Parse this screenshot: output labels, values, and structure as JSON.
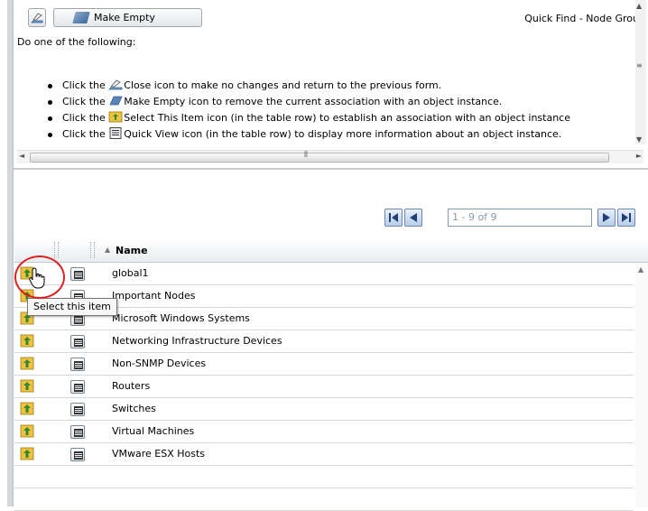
{
  "toolbar": {
    "make_empty_label": "Make Empty",
    "quick_find_title": "Quick Find - Node Grou"
  },
  "instructions": {
    "intro": "Do one of the following:",
    "steps": [
      {
        "pre": "Click the",
        "post": "Close icon to make no changes and return to the previous form.",
        "icon": "close-icon"
      },
      {
        "pre": "Click the",
        "post": "Make Empty icon to remove the current association with an object instance.",
        "icon": "make-empty-icon"
      },
      {
        "pre": "Click the",
        "post": "Select This Item icon (in the table row) to establish an association with an object instance",
        "icon": "select-item-icon"
      },
      {
        "pre": "Click the",
        "post": "Quick View icon (in the table row) to display more information about an object instance.",
        "icon": "quick-view-icon"
      }
    ]
  },
  "pager": {
    "range": "1 - 9 of 9"
  },
  "grid": {
    "column_name": "Name",
    "rows": [
      "global1",
      "Important Nodes",
      "Microsoft Windows Systems",
      "Networking Infrastructure Devices",
      "Non-SNMP Devices",
      "Routers",
      "Switches",
      "Virtual Machines",
      "VMware ESX Hosts"
    ]
  },
  "tooltip": "Select this item",
  "colors": {
    "highlight_circle": "#e02020",
    "select_icon": "#f0c040",
    "pager_button": "#b8cde8"
  }
}
